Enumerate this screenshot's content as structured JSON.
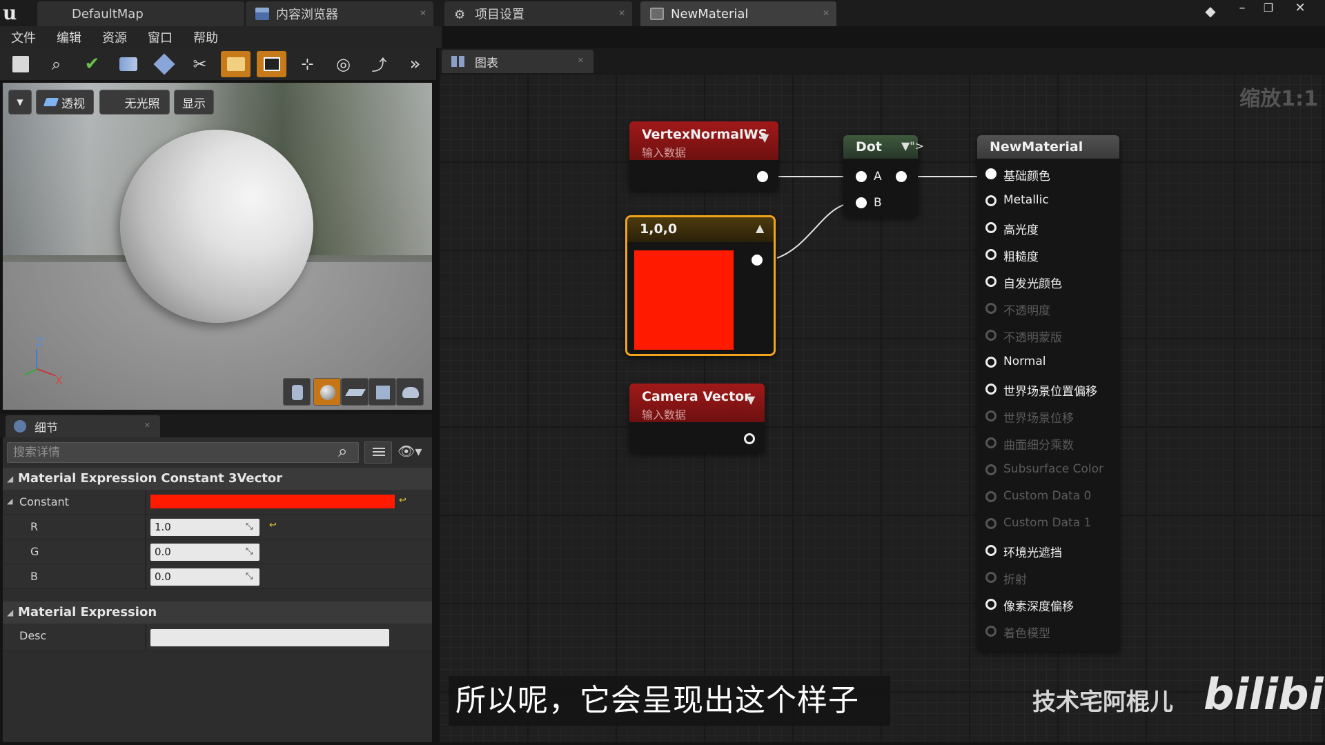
{
  "title_bar": {
    "tabs": [
      {
        "label": "DefaultMap"
      },
      {
        "label": "内容浏览器"
      },
      {
        "label": "项目设置"
      },
      {
        "label": "NewMaterial"
      }
    ]
  },
  "menu": {
    "items": [
      "文件",
      "编辑",
      "资源",
      "窗口",
      "帮助"
    ]
  },
  "toolbar": {
    "buttons": [
      "save-icon",
      "search-icon",
      "apply-icon",
      "nodes-icon",
      "home-icon",
      "clean-icon",
      "live-preview-icon",
      "realtime-icon",
      "stats-icon",
      "mobile-stats-icon",
      "hlsl-icon",
      "more-icon"
    ]
  },
  "viewport": {
    "perspective_label": "透视",
    "unlit_label": "无光照",
    "show_label": "显示",
    "axis_z": "Z",
    "axis_x": "X"
  },
  "details": {
    "tab_label": "细节",
    "search_placeholder": "搜索详情",
    "section1": "Material Expression Constant 3Vector",
    "constant_label": "Constant",
    "constant_color": "#ff1a00",
    "r_label": "R",
    "r_value": "1.0",
    "g_label": "G",
    "g_value": "0.0",
    "b_label": "B",
    "b_value": "0.0",
    "section2": "Material Expression",
    "desc_label": "Desc"
  },
  "graph": {
    "tab_label": "图表",
    "zoom_label": "缩放1:1",
    "nodes": {
      "vertex_normal": {
        "title": "VertexNormalWS",
        "subtitle": "输入数据"
      },
      "constant3": {
        "title": "1,0,0",
        "color": "#ff1a00"
      },
      "camera_vector": {
        "title": "Camera Vector",
        "subtitle": "输入数据"
      },
      "dot": {
        "title": "Dot",
        "pin_a": "A",
        "pin_b": "B"
      },
      "material": {
        "title": "NewMaterial",
        "pins": [
          {
            "label": "基础颜色",
            "state": "connected"
          },
          {
            "label": "Metallic",
            "state": "active"
          },
          {
            "label": "高光度",
            "state": "active"
          },
          {
            "label": "粗糙度",
            "state": "active"
          },
          {
            "label": "自发光颜色",
            "state": "active"
          },
          {
            "label": "不透明度",
            "state": "disabled"
          },
          {
            "label": "不透明蒙版",
            "state": "disabled"
          },
          {
            "label": "Normal",
            "state": "active"
          },
          {
            "label": "世界场景位置偏移",
            "state": "active"
          },
          {
            "label": "世界场景位移",
            "state": "disabled"
          },
          {
            "label": "曲面细分乘数",
            "state": "disabled"
          },
          {
            "label": "Subsurface Color",
            "state": "disabled"
          },
          {
            "label": "Custom Data 0",
            "state": "disabled"
          },
          {
            "label": "Custom Data 1",
            "state": "disabled"
          },
          {
            "label": "环境光遮挡",
            "state": "active"
          },
          {
            "label": "折射",
            "state": "disabled"
          },
          {
            "label": "像素深度偏移",
            "state": "active"
          },
          {
            "label": "着色模型",
            "state": "disabled"
          }
        ]
      }
    }
  },
  "overlay": {
    "subtitle": "所以呢，它会呈现出这个样子",
    "author": "技术宅阿棍儿",
    "brand": "bilibili"
  }
}
